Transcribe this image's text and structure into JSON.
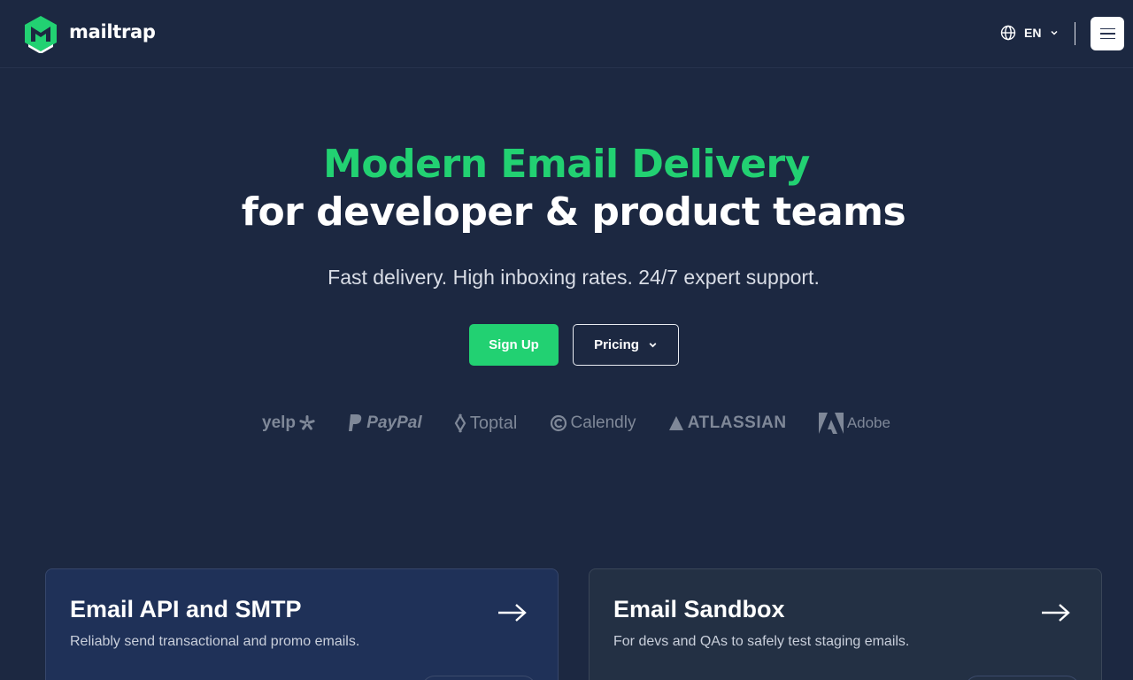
{
  "header": {
    "logo_text": "mailtrap",
    "language": "EN"
  },
  "hero": {
    "title_line1": "Modern Email Delivery",
    "title_line2": "for developer & product teams",
    "subtitle": "Fast delivery. High inboxing rates. 24/7 expert support.",
    "signup_label": "Sign Up",
    "pricing_label": "Pricing"
  },
  "brands": [
    "yelp",
    "PayPal",
    "Toptal",
    "Calendly",
    "ATLASSIAN",
    "Adobe"
  ],
  "cards": [
    {
      "title": "Email API and SMTP",
      "description": "Reliably send transactional and promo emails."
    },
    {
      "title": "Email Sandbox",
      "description": "For devs and QAs to safely test staging emails."
    }
  ],
  "colors": {
    "background": "#1c2841",
    "accent": "#22d172",
    "card_api": "#1f3158",
    "card_sandbox": "#233044"
  }
}
